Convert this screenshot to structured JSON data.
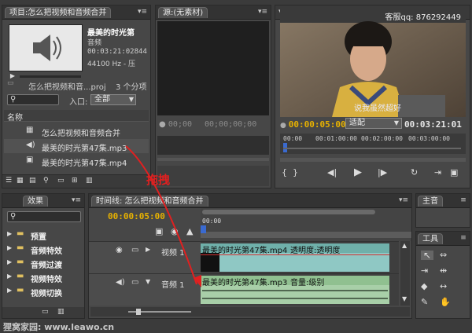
{
  "project": {
    "tab": "项目:怎么把视频和音频合并",
    "clip_name": "最美的时光第",
    "clip_type": "音频",
    "clip_duration": "00:03:21:02844",
    "clip_rate": "44100 Hz - 压",
    "project_file": "怎么把视频和音...proj",
    "item_count": "3 个分项",
    "in_label": "入口:",
    "in_value": "全部",
    "col_name": "名称",
    "items": [
      {
        "label": "怎么把视频和音频合并",
        "icon": "sequence-icon"
      },
      {
        "label": "最美的时光第47集.mp3",
        "icon": "audio-file-icon"
      },
      {
        "label": "最美的时光第47集.mp4",
        "icon": "video-file-icon"
      }
    ]
  },
  "source": {
    "tab": "源:(无素材)",
    "tc_left": "00;00",
    "tc_right": "00;00;00;00"
  },
  "program": {
    "watermark": "客服qq: 876292449",
    "subtitle": "说我虽然超好",
    "tc_current": "00:00:05:00",
    "fit_label": "适配",
    "tc_duration": "00:03:21:01",
    "ruler": [
      "00:00",
      "00:01:00:00",
      "00:02:00:00",
      "00:03:00:00"
    ]
  },
  "annotation": "拖拽",
  "effects": {
    "tab": "效果",
    "folders": [
      "预置",
      "音频特效",
      "音频过渡",
      "视频特效",
      "视频切换"
    ]
  },
  "timeline": {
    "tab": "时间线: 怎么把视频和音频合并",
    "tc": "00:00:05:00",
    "ruler": "00:00",
    "video_track": "视频 1",
    "audio_track": "音频 1",
    "video_clip": "最美的时光第47集.mp4",
    "video_effect": "透明度:透明度",
    "audio_clip": "最美的时光第47集.mp3",
    "audio_effect": "音量:级别"
  },
  "master": {
    "tab": "主音"
  },
  "tools": {
    "tab": "工具"
  },
  "footer": "狸窝家园: www.leawo.cn",
  "colors": {
    "accent_gold": "#e8b200",
    "video_clip": "#8fc8c4",
    "audio_clip": "#a8cfa8",
    "annotation_red": "#e02020"
  }
}
